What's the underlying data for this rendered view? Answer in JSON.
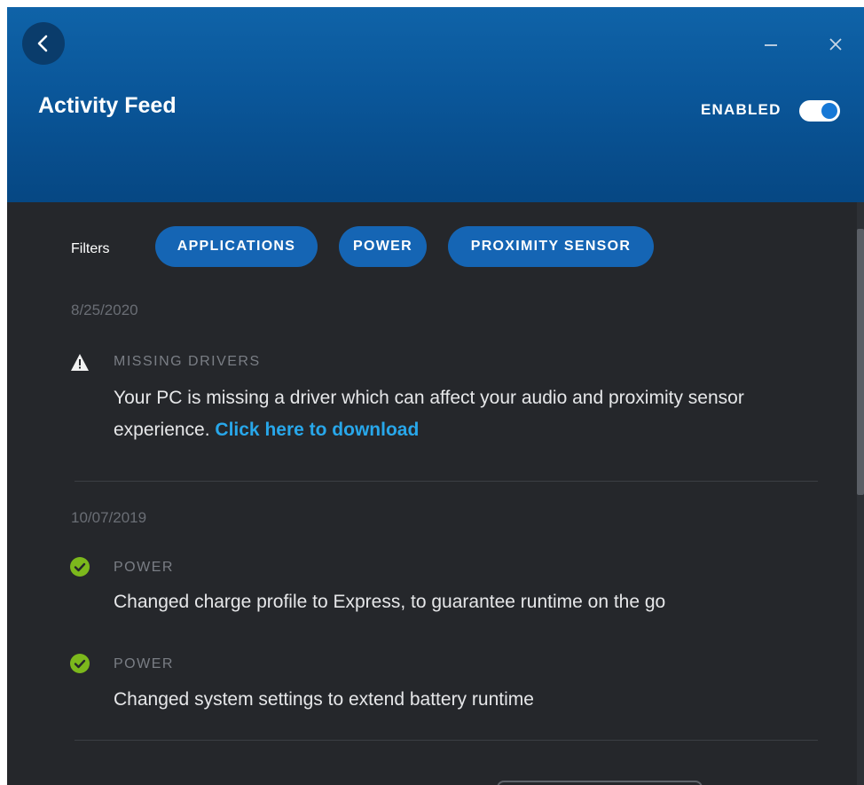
{
  "header": {
    "title": "Activity Feed",
    "enabled_label": "ENABLED",
    "toggle_on": true
  },
  "filters": {
    "label": "Filters",
    "chips": [
      "APPLICATIONS",
      "POWER",
      "PROXIMITY SENSOR"
    ]
  },
  "groups": [
    {
      "date": "8/25/2020",
      "items": [
        {
          "icon": "warning-icon",
          "category": "MISSING DRIVERS",
          "message": "Your PC is missing a driver which can affect your audio and proximity sensor experience.",
          "link": "Click here to download"
        }
      ]
    },
    {
      "date": "10/07/2019",
      "items": [
        {
          "icon": "check-circle-icon",
          "category": "POWER",
          "message": "Changed charge profile to Express, to guarantee runtime on the go"
        },
        {
          "icon": "check-circle-icon",
          "category": "POWER",
          "message": "Changed system settings to extend battery runtime"
        }
      ]
    }
  ],
  "colors": {
    "header_top": "#0f63a8",
    "header_bottom": "#064783",
    "background": "#25272b",
    "chip": "#1565b4",
    "link": "#28a7ea",
    "check": "#7cb81c",
    "toggle_knob": "#1678d6"
  }
}
